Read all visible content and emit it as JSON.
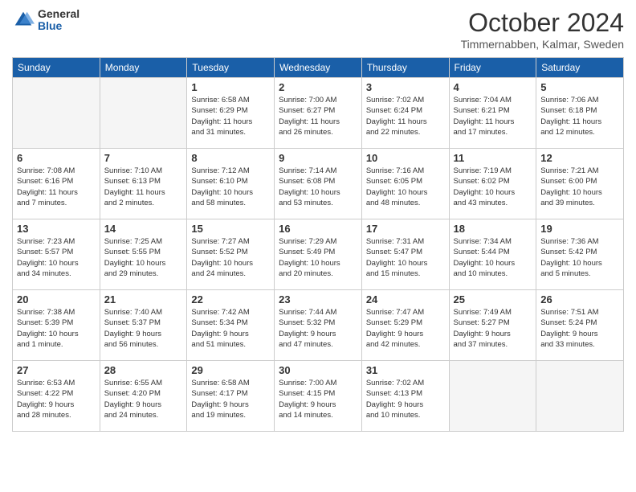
{
  "logo": {
    "general": "General",
    "blue": "Blue"
  },
  "title": "October 2024",
  "subtitle": "Timmernabben, Kalmar, Sweden",
  "headers": [
    "Sunday",
    "Monday",
    "Tuesday",
    "Wednesday",
    "Thursday",
    "Friday",
    "Saturday"
  ],
  "rows": [
    [
      {
        "num": "",
        "detail": ""
      },
      {
        "num": "",
        "detail": ""
      },
      {
        "num": "1",
        "detail": "Sunrise: 6:58 AM\nSunset: 6:29 PM\nDaylight: 11 hours\nand 31 minutes."
      },
      {
        "num": "2",
        "detail": "Sunrise: 7:00 AM\nSunset: 6:27 PM\nDaylight: 11 hours\nand 26 minutes."
      },
      {
        "num": "3",
        "detail": "Sunrise: 7:02 AM\nSunset: 6:24 PM\nDaylight: 11 hours\nand 22 minutes."
      },
      {
        "num": "4",
        "detail": "Sunrise: 7:04 AM\nSunset: 6:21 PM\nDaylight: 11 hours\nand 17 minutes."
      },
      {
        "num": "5",
        "detail": "Sunrise: 7:06 AM\nSunset: 6:18 PM\nDaylight: 11 hours\nand 12 minutes."
      }
    ],
    [
      {
        "num": "6",
        "detail": "Sunrise: 7:08 AM\nSunset: 6:16 PM\nDaylight: 11 hours\nand 7 minutes."
      },
      {
        "num": "7",
        "detail": "Sunrise: 7:10 AM\nSunset: 6:13 PM\nDaylight: 11 hours\nand 2 minutes."
      },
      {
        "num": "8",
        "detail": "Sunrise: 7:12 AM\nSunset: 6:10 PM\nDaylight: 10 hours\nand 58 minutes."
      },
      {
        "num": "9",
        "detail": "Sunrise: 7:14 AM\nSunset: 6:08 PM\nDaylight: 10 hours\nand 53 minutes."
      },
      {
        "num": "10",
        "detail": "Sunrise: 7:16 AM\nSunset: 6:05 PM\nDaylight: 10 hours\nand 48 minutes."
      },
      {
        "num": "11",
        "detail": "Sunrise: 7:19 AM\nSunset: 6:02 PM\nDaylight: 10 hours\nand 43 minutes."
      },
      {
        "num": "12",
        "detail": "Sunrise: 7:21 AM\nSunset: 6:00 PM\nDaylight: 10 hours\nand 39 minutes."
      }
    ],
    [
      {
        "num": "13",
        "detail": "Sunrise: 7:23 AM\nSunset: 5:57 PM\nDaylight: 10 hours\nand 34 minutes."
      },
      {
        "num": "14",
        "detail": "Sunrise: 7:25 AM\nSunset: 5:55 PM\nDaylight: 10 hours\nand 29 minutes."
      },
      {
        "num": "15",
        "detail": "Sunrise: 7:27 AM\nSunset: 5:52 PM\nDaylight: 10 hours\nand 24 minutes."
      },
      {
        "num": "16",
        "detail": "Sunrise: 7:29 AM\nSunset: 5:49 PM\nDaylight: 10 hours\nand 20 minutes."
      },
      {
        "num": "17",
        "detail": "Sunrise: 7:31 AM\nSunset: 5:47 PM\nDaylight: 10 hours\nand 15 minutes."
      },
      {
        "num": "18",
        "detail": "Sunrise: 7:34 AM\nSunset: 5:44 PM\nDaylight: 10 hours\nand 10 minutes."
      },
      {
        "num": "19",
        "detail": "Sunrise: 7:36 AM\nSunset: 5:42 PM\nDaylight: 10 hours\nand 5 minutes."
      }
    ],
    [
      {
        "num": "20",
        "detail": "Sunrise: 7:38 AM\nSunset: 5:39 PM\nDaylight: 10 hours\nand 1 minute."
      },
      {
        "num": "21",
        "detail": "Sunrise: 7:40 AM\nSunset: 5:37 PM\nDaylight: 9 hours\nand 56 minutes."
      },
      {
        "num": "22",
        "detail": "Sunrise: 7:42 AM\nSunset: 5:34 PM\nDaylight: 9 hours\nand 51 minutes."
      },
      {
        "num": "23",
        "detail": "Sunrise: 7:44 AM\nSunset: 5:32 PM\nDaylight: 9 hours\nand 47 minutes."
      },
      {
        "num": "24",
        "detail": "Sunrise: 7:47 AM\nSunset: 5:29 PM\nDaylight: 9 hours\nand 42 minutes."
      },
      {
        "num": "25",
        "detail": "Sunrise: 7:49 AM\nSunset: 5:27 PM\nDaylight: 9 hours\nand 37 minutes."
      },
      {
        "num": "26",
        "detail": "Sunrise: 7:51 AM\nSunset: 5:24 PM\nDaylight: 9 hours\nand 33 minutes."
      }
    ],
    [
      {
        "num": "27",
        "detail": "Sunrise: 6:53 AM\nSunset: 4:22 PM\nDaylight: 9 hours\nand 28 minutes."
      },
      {
        "num": "28",
        "detail": "Sunrise: 6:55 AM\nSunset: 4:20 PM\nDaylight: 9 hours\nand 24 minutes."
      },
      {
        "num": "29",
        "detail": "Sunrise: 6:58 AM\nSunset: 4:17 PM\nDaylight: 9 hours\nand 19 minutes."
      },
      {
        "num": "30",
        "detail": "Sunrise: 7:00 AM\nSunset: 4:15 PM\nDaylight: 9 hours\nand 14 minutes."
      },
      {
        "num": "31",
        "detail": "Sunrise: 7:02 AM\nSunset: 4:13 PM\nDaylight: 9 hours\nand 10 minutes."
      },
      {
        "num": "",
        "detail": ""
      },
      {
        "num": "",
        "detail": ""
      }
    ]
  ]
}
